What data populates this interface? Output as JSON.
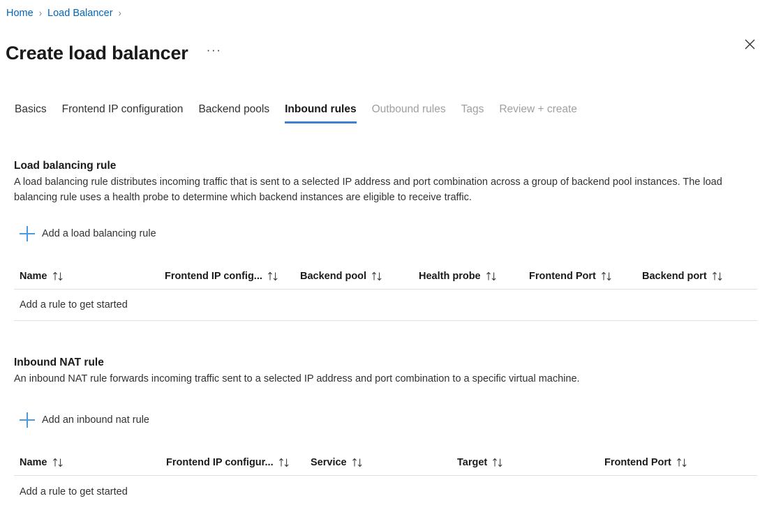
{
  "breadcrumb": {
    "items": [
      {
        "label": "Home"
      },
      {
        "label": "Load Balancer"
      }
    ],
    "separator": "›"
  },
  "header": {
    "title": "Create load balancer",
    "more_label": "···",
    "close_icon": "close-icon"
  },
  "tabs": [
    {
      "label": "Basics",
      "state": "enabled"
    },
    {
      "label": "Frontend IP configuration",
      "state": "enabled"
    },
    {
      "label": "Backend pools",
      "state": "enabled"
    },
    {
      "label": "Inbound rules",
      "state": "active"
    },
    {
      "label": "Outbound rules",
      "state": "disabled"
    },
    {
      "label": "Tags",
      "state": "disabled"
    },
    {
      "label": "Review + create",
      "state": "disabled"
    }
  ],
  "colors": {
    "accent": "#3b82d6",
    "link": "#0066bb",
    "plus": "#4a9ae0",
    "text": "#323130",
    "disabled_text": "#a19f9d",
    "border": "#e1dfdd"
  },
  "sections": {
    "load_balancing_rule": {
      "heading": "Load balancing rule",
      "description": "A load balancing rule distributes incoming traffic that is sent to a selected IP address and port combination across a group of backend pool instances. The load balancing rule uses a health probe to determine which backend instances are eligible to receive traffic.",
      "add_label": "Add a load balancing rule",
      "columns": [
        {
          "label": "Name",
          "sort": "↑↓"
        },
        {
          "label": "Frontend IP config...",
          "sort": "↑↓"
        },
        {
          "label": "Backend pool",
          "sort": "↑↓"
        },
        {
          "label": "Health probe",
          "sort": "↑↓"
        },
        {
          "label": "Frontend Port",
          "sort": "↑↓"
        },
        {
          "label": "Backend port",
          "sort": "↑↓"
        }
      ],
      "rows": [],
      "empty_text": "Add a rule to get started"
    },
    "inbound_nat_rule": {
      "heading": "Inbound NAT rule",
      "description": "An inbound NAT rule forwards incoming traffic sent to a selected IP address and port combination to a specific virtual machine.",
      "add_label": "Add an inbound nat rule",
      "columns": [
        {
          "label": "Name",
          "sort": "↑↓"
        },
        {
          "label": "Frontend IP configur...",
          "sort": "↑↓"
        },
        {
          "label": "Service",
          "sort": "↑↓"
        },
        {
          "label": "Target",
          "sort": "↑↓"
        },
        {
          "label": "Frontend Port",
          "sort": "↑↓"
        }
      ],
      "rows": [],
      "empty_text": "Add a rule to get started"
    }
  }
}
